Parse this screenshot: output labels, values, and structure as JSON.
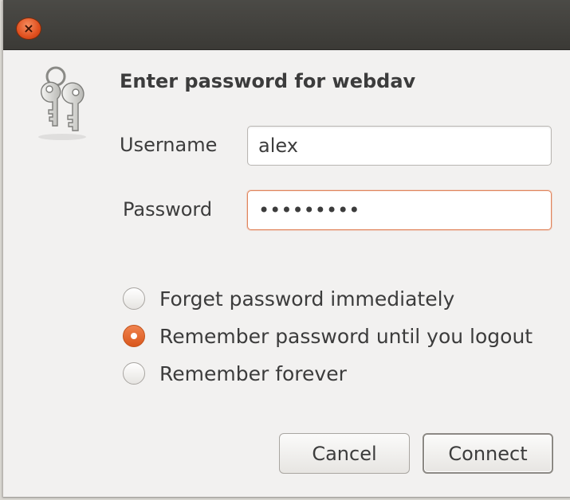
{
  "window": {
    "close_icon": "close-icon",
    "close_glyph": "×"
  },
  "dialog": {
    "icon": "keys-icon",
    "title": "Enter password for webdav"
  },
  "form": {
    "username_label": "Username",
    "username_value": "alex",
    "password_label": "Password",
    "password_value": "•••••••••"
  },
  "remember": {
    "options": [
      {
        "label": "Forget password immediately",
        "checked": false
      },
      {
        "label": "Remember password until you logout",
        "checked": true
      },
      {
        "label": "Remember forever",
        "checked": false
      }
    ]
  },
  "buttons": {
    "cancel_label": "Cancel",
    "connect_label": "Connect"
  },
  "colors": {
    "accent": "#e0501f",
    "titlebar": "#3c3b37",
    "dialog_bg": "#f2f1f0",
    "focus_border": "#e0855c"
  }
}
